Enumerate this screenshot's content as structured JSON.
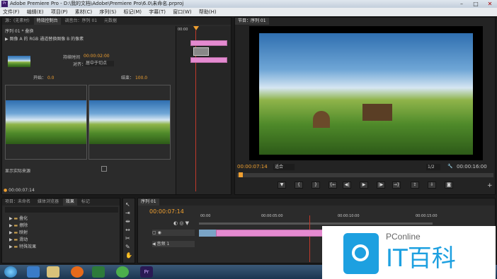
{
  "window": {
    "title": "Adobe Premiere Pro - D:\\我的文档\\Adobe\\Premiere Pro\\6.0\\未命名.prproj",
    "app_icon": "Pr"
  },
  "menu": [
    "文件(F)",
    "编辑(E)",
    "项目(P)",
    "素材(C)",
    "序列(S)",
    "标记(M)",
    "字幕(T)",
    "窗口(W)",
    "帮助(H)"
  ],
  "source_panel": {
    "tabs": [
      "源：(无素材)",
      "特效控制台",
      "调音台：序列 01",
      "元数据"
    ],
    "sequence_label": "序列 01 * 叠换",
    "effect_desc": "图像 A 的 RGB 通道替换图像 B 的像素",
    "duration_label": "持续时间",
    "duration_value": "00:00:02:00",
    "align_label": "对齐：",
    "align_value": "居中于切点",
    "start_label": "开始：",
    "start_value": "0.0",
    "end_label": "结束：",
    "end_value": "100.0",
    "show_source_label": "显示实际来源",
    "timecode": "00:00:07:14",
    "mini_timecode": "00:00"
  },
  "program_panel": {
    "tab": "节目：序列 01",
    "timecode": "00:00:07:14",
    "fit_label": "适合",
    "ratio": "1/2",
    "duration": "00:00:16:00"
  },
  "project_panel": {
    "tabs": [
      "项目：未命名",
      "媒体浏览器",
      "效果",
      "标记"
    ],
    "folders": [
      "叠化",
      "擦除",
      "映射",
      "滑动",
      "特殊效果"
    ]
  },
  "timeline_panel": {
    "tab": "序列 01",
    "timecode": "00:00:07:14",
    "ruler": [
      "00:00",
      "00:00:05:00",
      "00:00:10:00",
      "00:00:15:00"
    ],
    "track_label": "音频 1"
  },
  "watermark": {
    "brand": "PConline",
    "text": "IT百科"
  }
}
